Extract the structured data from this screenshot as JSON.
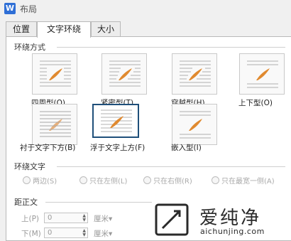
{
  "window": {
    "title": "布局",
    "app_icon": "W"
  },
  "tabs": [
    {
      "label": "位置",
      "active": false
    },
    {
      "label": "文字环绕",
      "active": true
    },
    {
      "label": "大小",
      "active": false
    }
  ],
  "wrap_style": {
    "section_label": "环绕方式",
    "options": [
      {
        "label": "四周型(Q)",
        "selected": false
      },
      {
        "label": "紧密型(T)",
        "selected": false
      },
      {
        "label": "穿越型(H)",
        "selected": false
      },
      {
        "label": "上下型(O)",
        "selected": false
      },
      {
        "label": "衬于文字下方(B)",
        "selected": false
      },
      {
        "label": "浮于文字上方(F)",
        "selected": true
      },
      {
        "label": "嵌入型(I)",
        "selected": false
      }
    ]
  },
  "wrap_text": {
    "section_label": "环绕文字",
    "options": [
      {
        "label": "两边(S)"
      },
      {
        "label": "只在左侧(L)"
      },
      {
        "label": "只在右侧(R)"
      },
      {
        "label": "只在最宽一侧(A)"
      }
    ]
  },
  "distance": {
    "section_label": "距正文",
    "top": {
      "label": "上(P)",
      "value": "0",
      "unit": "厘米▾"
    },
    "bottom": {
      "label": "下(M)",
      "value": "0",
      "unit": "厘米▾"
    }
  },
  "watermark": {
    "cn": "爱纯净",
    "en": "aichunjing.com"
  },
  "colors": {
    "accent": "#1f4f7a",
    "icon_pen": "#e08a30",
    "app_icon": "#2f6fd6"
  }
}
